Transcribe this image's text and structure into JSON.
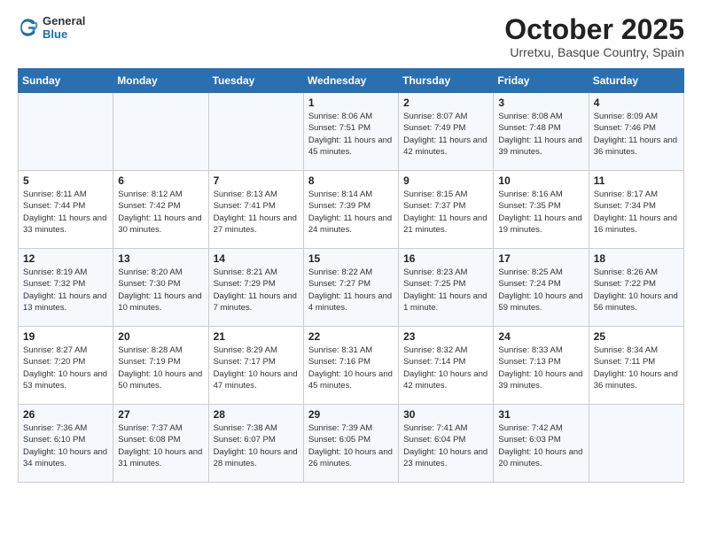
{
  "header": {
    "logo_general": "General",
    "logo_blue": "Blue",
    "month_title": "October 2025",
    "subtitle": "Urretxu, Basque Country, Spain"
  },
  "weekdays": [
    "Sunday",
    "Monday",
    "Tuesday",
    "Wednesday",
    "Thursday",
    "Friday",
    "Saturday"
  ],
  "weeks": [
    [
      {
        "day": "",
        "info": ""
      },
      {
        "day": "",
        "info": ""
      },
      {
        "day": "",
        "info": ""
      },
      {
        "day": "1",
        "info": "Sunrise: 8:06 AM\nSunset: 7:51 PM\nDaylight: 11 hours and 45 minutes."
      },
      {
        "day": "2",
        "info": "Sunrise: 8:07 AM\nSunset: 7:49 PM\nDaylight: 11 hours and 42 minutes."
      },
      {
        "day": "3",
        "info": "Sunrise: 8:08 AM\nSunset: 7:48 PM\nDaylight: 11 hours and 39 minutes."
      },
      {
        "day": "4",
        "info": "Sunrise: 8:09 AM\nSunset: 7:46 PM\nDaylight: 11 hours and 36 minutes."
      }
    ],
    [
      {
        "day": "5",
        "info": "Sunrise: 8:11 AM\nSunset: 7:44 PM\nDaylight: 11 hours and 33 minutes."
      },
      {
        "day": "6",
        "info": "Sunrise: 8:12 AM\nSunset: 7:42 PM\nDaylight: 11 hours and 30 minutes."
      },
      {
        "day": "7",
        "info": "Sunrise: 8:13 AM\nSunset: 7:41 PM\nDaylight: 11 hours and 27 minutes."
      },
      {
        "day": "8",
        "info": "Sunrise: 8:14 AM\nSunset: 7:39 PM\nDaylight: 11 hours and 24 minutes."
      },
      {
        "day": "9",
        "info": "Sunrise: 8:15 AM\nSunset: 7:37 PM\nDaylight: 11 hours and 21 minutes."
      },
      {
        "day": "10",
        "info": "Sunrise: 8:16 AM\nSunset: 7:35 PM\nDaylight: 11 hours and 19 minutes."
      },
      {
        "day": "11",
        "info": "Sunrise: 8:17 AM\nSunset: 7:34 PM\nDaylight: 11 hours and 16 minutes."
      }
    ],
    [
      {
        "day": "12",
        "info": "Sunrise: 8:19 AM\nSunset: 7:32 PM\nDaylight: 11 hours and 13 minutes."
      },
      {
        "day": "13",
        "info": "Sunrise: 8:20 AM\nSunset: 7:30 PM\nDaylight: 11 hours and 10 minutes."
      },
      {
        "day": "14",
        "info": "Sunrise: 8:21 AM\nSunset: 7:29 PM\nDaylight: 11 hours and 7 minutes."
      },
      {
        "day": "15",
        "info": "Sunrise: 8:22 AM\nSunset: 7:27 PM\nDaylight: 11 hours and 4 minutes."
      },
      {
        "day": "16",
        "info": "Sunrise: 8:23 AM\nSunset: 7:25 PM\nDaylight: 11 hours and 1 minute."
      },
      {
        "day": "17",
        "info": "Sunrise: 8:25 AM\nSunset: 7:24 PM\nDaylight: 10 hours and 59 minutes."
      },
      {
        "day": "18",
        "info": "Sunrise: 8:26 AM\nSunset: 7:22 PM\nDaylight: 10 hours and 56 minutes."
      }
    ],
    [
      {
        "day": "19",
        "info": "Sunrise: 8:27 AM\nSunset: 7:20 PM\nDaylight: 10 hours and 53 minutes."
      },
      {
        "day": "20",
        "info": "Sunrise: 8:28 AM\nSunset: 7:19 PM\nDaylight: 10 hours and 50 minutes."
      },
      {
        "day": "21",
        "info": "Sunrise: 8:29 AM\nSunset: 7:17 PM\nDaylight: 10 hours and 47 minutes."
      },
      {
        "day": "22",
        "info": "Sunrise: 8:31 AM\nSunset: 7:16 PM\nDaylight: 10 hours and 45 minutes."
      },
      {
        "day": "23",
        "info": "Sunrise: 8:32 AM\nSunset: 7:14 PM\nDaylight: 10 hours and 42 minutes."
      },
      {
        "day": "24",
        "info": "Sunrise: 8:33 AM\nSunset: 7:13 PM\nDaylight: 10 hours and 39 minutes."
      },
      {
        "day": "25",
        "info": "Sunrise: 8:34 AM\nSunset: 7:11 PM\nDaylight: 10 hours and 36 minutes."
      }
    ],
    [
      {
        "day": "26",
        "info": "Sunrise: 7:36 AM\nSunset: 6:10 PM\nDaylight: 10 hours and 34 minutes."
      },
      {
        "day": "27",
        "info": "Sunrise: 7:37 AM\nSunset: 6:08 PM\nDaylight: 10 hours and 31 minutes."
      },
      {
        "day": "28",
        "info": "Sunrise: 7:38 AM\nSunset: 6:07 PM\nDaylight: 10 hours and 28 minutes."
      },
      {
        "day": "29",
        "info": "Sunrise: 7:39 AM\nSunset: 6:05 PM\nDaylight: 10 hours and 26 minutes."
      },
      {
        "day": "30",
        "info": "Sunrise: 7:41 AM\nSunset: 6:04 PM\nDaylight: 10 hours and 23 minutes."
      },
      {
        "day": "31",
        "info": "Sunrise: 7:42 AM\nSunset: 6:03 PM\nDaylight: 10 hours and 20 minutes."
      },
      {
        "day": "",
        "info": ""
      }
    ]
  ]
}
